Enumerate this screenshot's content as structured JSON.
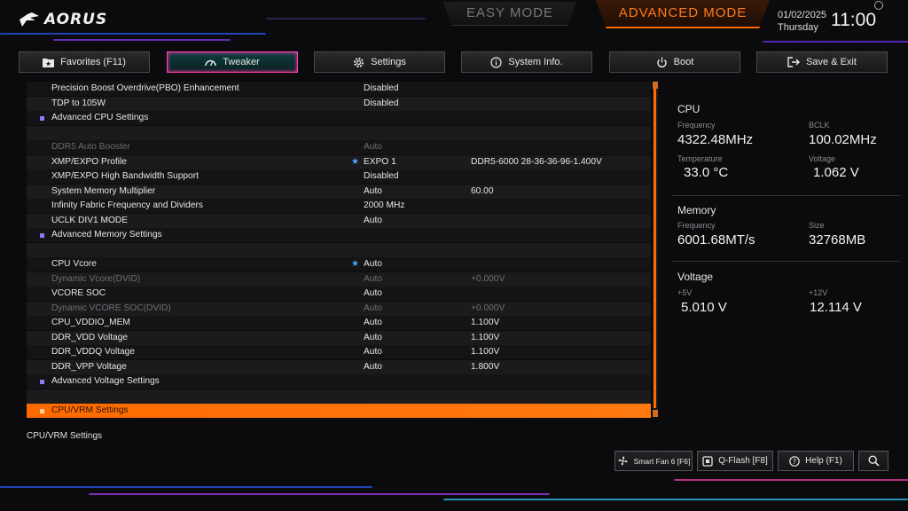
{
  "header": {
    "brand": "AORUS",
    "easy_mode": "EASY MODE",
    "advanced_mode": "ADVANCED MODE",
    "date": "01/02/2025",
    "weekday": "Thursday",
    "time": "11:00"
  },
  "tabs": [
    {
      "label": "Favorites (F11)",
      "icon": "star-folder-icon"
    },
    {
      "label": "Tweaker",
      "icon": "gauge-icon",
      "active": true
    },
    {
      "label": "Settings",
      "icon": "gear-icon"
    },
    {
      "label": "System Info.",
      "icon": "info-icon"
    },
    {
      "label": "Boot",
      "icon": "power-icon"
    },
    {
      "label": "Save & Exit",
      "icon": "exit-icon"
    }
  ],
  "rows": [
    {
      "label": "Precision Boost Overdrive(PBO) Enhancement",
      "value": "Disabled",
      "extra": ""
    },
    {
      "label": "TDP to 105W",
      "value": "Disabled",
      "extra": ""
    },
    {
      "label": "Advanced CPU Settings",
      "value": "",
      "extra": "",
      "submenu": true
    },
    {
      "label": "",
      "value": "",
      "extra": ""
    },
    {
      "label": "DDR5 Auto Booster",
      "value": "Auto",
      "extra": "",
      "dim": true
    },
    {
      "label": "XMP/EXPO Profile",
      "value": "EXPO 1",
      "extra": "DDR5-6000 28-36-36-96-1.400V",
      "star": true
    },
    {
      "label": "XMP/EXPO High Bandwidth Support",
      "value": "Disabled",
      "extra": ""
    },
    {
      "label": "System Memory Multiplier",
      "value": "Auto",
      "extra": "60.00"
    },
    {
      "label": "Infinity Fabric Frequency and Dividers",
      "value": "2000 MHz",
      "extra": ""
    },
    {
      "label": "UCLK DIV1 MODE",
      "value": "Auto",
      "extra": ""
    },
    {
      "label": "Advanced Memory Settings",
      "value": "",
      "extra": "",
      "submenu": true
    },
    {
      "label": "",
      "value": "",
      "extra": ""
    },
    {
      "label": "CPU Vcore",
      "value": "Auto",
      "extra": "",
      "star": true
    },
    {
      "label": "Dynamic Vcore(DVID)",
      "value": "Auto",
      "extra": "+0.000V",
      "dim": true
    },
    {
      "label": "VCORE SOC",
      "value": "Auto",
      "extra": ""
    },
    {
      "label": "Dynamic VCORE SOC(DVID)",
      "value": "Auto",
      "extra": "+0.000V",
      "dim": true
    },
    {
      "label": "CPU_VDDIO_MEM",
      "value": "Auto",
      "extra": "1.100V"
    },
    {
      "label": "DDR_VDD Voltage",
      "value": "Auto",
      "extra": "1.100V"
    },
    {
      "label": "DDR_VDDQ Voltage",
      "value": "Auto",
      "extra": "1.100V"
    },
    {
      "label": "DDR_VPP Voltage",
      "value": "Auto",
      "extra": "1.800V"
    },
    {
      "label": "Advanced Voltage Settings",
      "value": "",
      "extra": "",
      "submenu": true
    },
    {
      "label": "",
      "value": "",
      "extra": ""
    },
    {
      "label": "CPU/VRM Settings",
      "value": "",
      "extra": "",
      "submenu": true,
      "selected": true
    }
  ],
  "help_text": "CPU/VRM Settings",
  "info": {
    "cpu": {
      "title": "CPU",
      "freq_label": "Frequency",
      "freq": "4322.48MHz",
      "bclk_label": "BCLK",
      "bclk": "100.02MHz",
      "temp_label": "Temperature",
      "temp": "33.0 °C",
      "volt_label": "Voltage",
      "volt": "1.062 V"
    },
    "memory": {
      "title": "Memory",
      "freq_label": "Frequency",
      "freq": "6001.68MT/s",
      "size_label": "Size",
      "size": "32768MB"
    },
    "voltage": {
      "title": "Voltage",
      "v5_label": "+5V",
      "v5": "5.010 V",
      "v12_label": "+12V",
      "v12": "12.114 V"
    }
  },
  "bottom": {
    "smart_fan": "Smart Fan 6 [F6]",
    "qflash": "Q-Flash [F8]",
    "help": "Help (F1)"
  },
  "colors": {
    "accent": "#ff6a00",
    "active_tab_border": "#ff3fb0",
    "star": "#4da6ff",
    "submenu_bullet": "#8a7cff"
  }
}
